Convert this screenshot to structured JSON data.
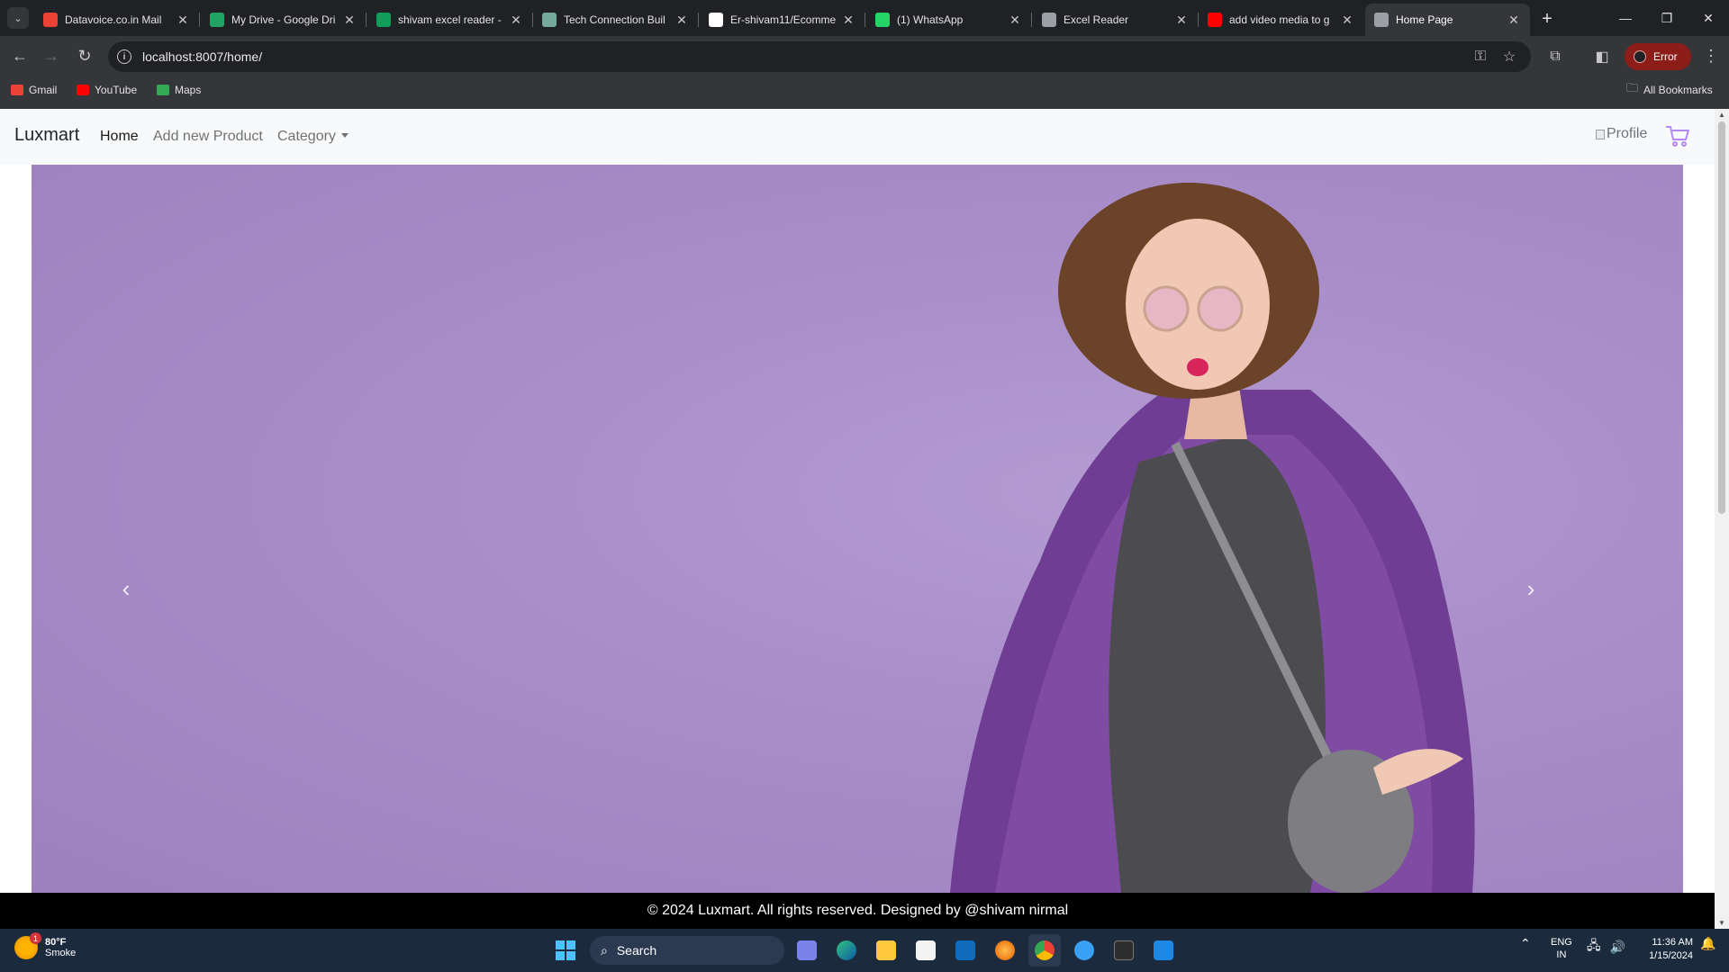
{
  "browser": {
    "tabs": [
      {
        "title": "Datavoice.co.in Mail",
        "icon": "gmail-icon",
        "color": "#ea4335",
        "active": false
      },
      {
        "title": "My Drive - Google Dri",
        "icon": "google-drive-icon",
        "color": "#1fa463",
        "active": false
      },
      {
        "title": "shivam excel reader -",
        "icon": "google-sheets-icon",
        "color": "#0f9d58",
        "active": false
      },
      {
        "title": "Tech Connection Buil",
        "icon": "chatgpt-icon",
        "color": "#74aa9c",
        "active": false
      },
      {
        "title": "Er-shivam11/Ecomme",
        "icon": "github-icon",
        "color": "#ffffff",
        "active": false
      },
      {
        "title": "(1) WhatsApp",
        "icon": "whatsapp-icon",
        "color": "#25d366",
        "active": false
      },
      {
        "title": "Excel Reader",
        "icon": "globe-icon",
        "color": "#9aa0a6",
        "active": false
      },
      {
        "title": "add video media to g",
        "icon": "youtube-icon",
        "color": "#ff0000",
        "active": false
      },
      {
        "title": "Home Page",
        "icon": "globe-icon",
        "color": "#9aa0a6",
        "active": true
      }
    ],
    "url": "localhost:8007/home/",
    "profile_status": "Error",
    "bookmarks": [
      {
        "label": "Gmail",
        "icon": "gmail-icon",
        "color": "#ea4335"
      },
      {
        "label": "YouTube",
        "icon": "youtube-icon",
        "color": "#ff0000"
      },
      {
        "label": "Maps",
        "icon": "maps-icon",
        "color": "#34a853"
      }
    ],
    "all_bookmarks": "All Bookmarks"
  },
  "site": {
    "brand": "Luxmart",
    "nav": {
      "home": "Home",
      "add_product": "Add new Product",
      "category": "Category"
    },
    "profile_alt": "Profile",
    "hero_bg_color": "#a98fc8",
    "footer": "© 2024 Luxmart. All rights reserved. Designed by @shivam nirmal"
  },
  "taskbar": {
    "weather_temp": "80°F",
    "weather_desc": "Smoke",
    "weather_badge": "1",
    "search_label": "Search",
    "lang_top": "ENG",
    "lang_bottom": "IN",
    "time": "11:36 AM",
    "date": "1/15/2024"
  }
}
